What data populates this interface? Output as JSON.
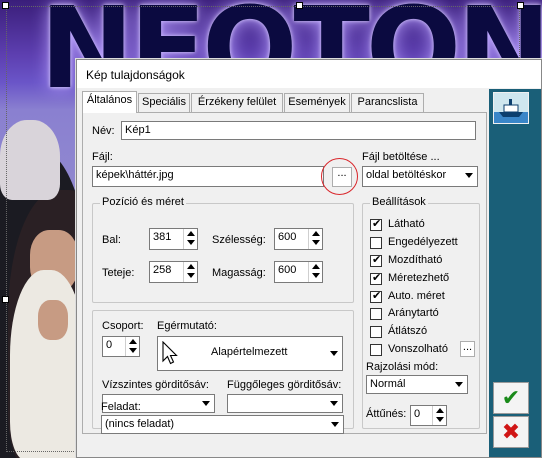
{
  "dialog": {
    "title": "Kép tulajdonságok"
  },
  "tabs": [
    {
      "label": "Általános",
      "active": true
    },
    {
      "label": "Speciális"
    },
    {
      "label": "Érzékeny felület"
    },
    {
      "label": "Események"
    },
    {
      "label": "Parancslista"
    }
  ],
  "general": {
    "name_label": "Név:",
    "name_value": "Kép1",
    "file_label": "Fájl:",
    "file_value": "képek\\háttér.jpg",
    "browse_label": "...",
    "load_label": "Fájl betöltése ...",
    "load_value": "oldal betöltéskor"
  },
  "position": {
    "title": "Pozíció és méret",
    "left_label": "Bal:",
    "left_value": "381",
    "top_label": "Teteje:",
    "top_value": "258",
    "width_label": "Szélesség:",
    "width_value": "600",
    "height_label": "Magasság:",
    "height_value": "600"
  },
  "misc": {
    "group_label": "Csoport:",
    "group_value": "0",
    "cursor_label": "Egérmutató:",
    "cursor_value": "Alapértelmezett",
    "hscroll_label": "Vízszintes görditősáv:",
    "hscroll_value": "",
    "vscroll_label": "Függőleges görditősáv:",
    "vscroll_value": "",
    "task_label": "Feladat:",
    "task_value": "(nincs feladat)"
  },
  "settings": {
    "title": "Beállítások",
    "items": [
      {
        "label": "Látható",
        "checked": true
      },
      {
        "label": "Engedélyezett",
        "checked": false
      },
      {
        "label": "Mozdítható",
        "checked": true
      },
      {
        "label": "Méretezhető",
        "checked": true
      },
      {
        "label": "Auto. méret",
        "checked": true
      },
      {
        "label": "Aránytartó",
        "checked": false
      },
      {
        "label": "Átlátszó",
        "checked": false
      },
      {
        "label": "Vonszolható",
        "checked": false
      }
    ],
    "drag_more_label": "...",
    "draw_mode_label": "Rajzolási mód:",
    "draw_mode_value": "Normál",
    "opacity_label": "Áttűnés:",
    "opacity_value": "0"
  },
  "buttons": {
    "ok_icon": "checkmark-icon",
    "cancel_icon": "x-icon"
  },
  "colors": {
    "ok": "#1a8a1a",
    "cancel": "#d01515",
    "highlight_ring": "#d9262b"
  }
}
